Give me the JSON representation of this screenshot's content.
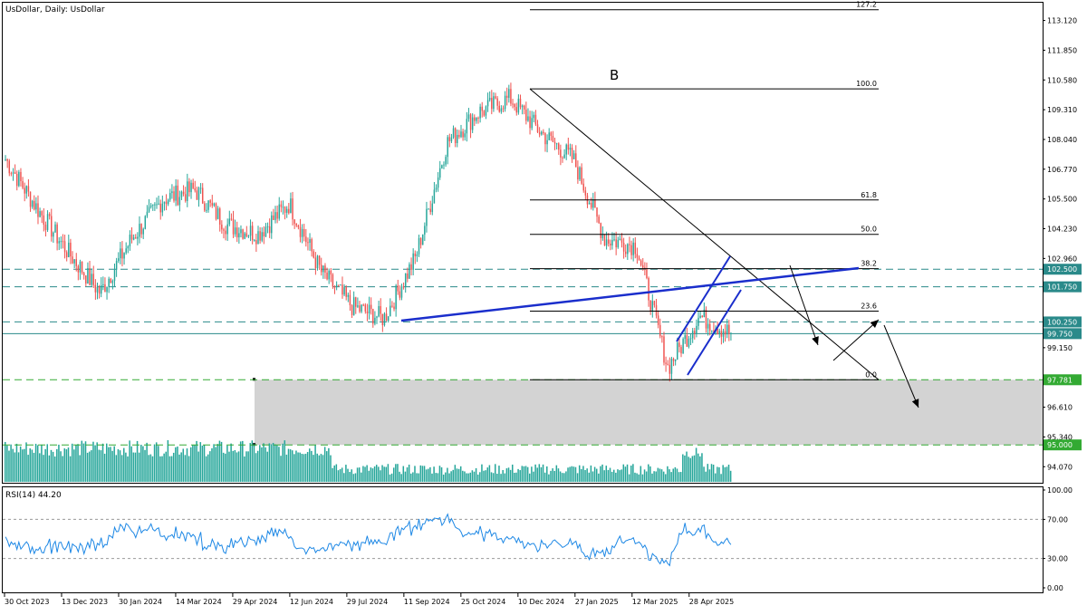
{
  "header": {
    "main_title": "UsDollar, Daily:  UsDollar",
    "rsi_title": "RSI(14) 44.20"
  },
  "wave_label": "B",
  "price_axis": {
    "ticks": [
      "113.120",
      "111.850",
      "110.580",
      "109.310",
      "108.040",
      "106.770",
      "105.500",
      "104.230",
      "102.960",
      "99.150",
      "96.610",
      "95.340",
      "94.070"
    ],
    "badges": [
      {
        "text": "102.500",
        "kind": "dashed-teal"
      },
      {
        "text": "101.750",
        "kind": "dashed-teal"
      },
      {
        "text": "100.250",
        "kind": "dashed-teal"
      },
      {
        "text": "99.750",
        "kind": "current"
      },
      {
        "text": "97.781",
        "kind": "dashed-green"
      },
      {
        "text": "95.000",
        "kind": "dashed-green"
      }
    ]
  },
  "fib_levels": [
    "127.2",
    "100.0",
    "61.8",
    "50.0",
    "38.2",
    "23.6",
    "0.0"
  ],
  "rsi_axis": {
    "ticks": [
      "100.00",
      "70.00",
      "30.00",
      "0.00"
    ],
    "levels": [
      70,
      30
    ]
  },
  "time_axis": [
    "30 Oct 2023",
    "13 Dec 2023",
    "30 Jan 2024",
    "14 Mar 2024",
    "29 Apr 2024",
    "12 Jun 2024",
    "29 Jul 2024",
    "11 Sep 2024",
    "25 Oct 2024",
    "10 Dec 2024",
    "27 Jan 2025",
    "12 Mar 2025",
    "28 Apr 2025"
  ],
  "colors": {
    "bull": "#26a69a",
    "bear": "#ef5350",
    "teal_line": "#2a8a8a",
    "green_line": "#33aa33",
    "channel_blue": "#1a2ecc",
    "rsi_line": "#1e88e5",
    "zone": "#d3d3d3"
  },
  "chart_data": {
    "type": "candlestick",
    "symbol": "UsDollar",
    "timeframe": "Daily",
    "x": [
      "30 Oct 2023",
      "13 Dec 2023",
      "30 Jan 2024",
      "14 Mar 2024",
      "29 Apr 2024",
      "12 Jun 2024",
      "29 Jul 2024",
      "11 Sep 2024",
      "25 Oct 2024",
      "10 Dec 2024",
      "27 Jan 2025",
      "12 Mar 2025",
      "28 Apr 2025"
    ],
    "close_path": [
      107.2,
      105.1,
      103.2,
      101.5,
      103.8,
      105.5,
      105.9,
      104.4,
      104.0,
      105.3,
      102.4,
      100.9,
      100.4,
      103.0,
      107.9,
      109.2,
      109.8,
      108.3,
      107.2,
      103.8,
      103.5,
      98.3,
      100.5,
      99.75
    ],
    "ylim": [
      93.5,
      113.8
    ],
    "key_levels": [
      102.5,
      101.75,
      100.25,
      99.75,
      97.781,
      95.0
    ],
    "fibonacci": {
      "anchor_high": 110.2,
      "anchor_low": 97.781,
      "levels": [
        127.2,
        100.0,
        61.8,
        50.0,
        38.2,
        23.6,
        0.0
      ]
    },
    "rsi": {
      "period": 14,
      "last": 44.2,
      "levels": [
        30,
        70
      ],
      "ylim": [
        0,
        100
      ]
    }
  }
}
